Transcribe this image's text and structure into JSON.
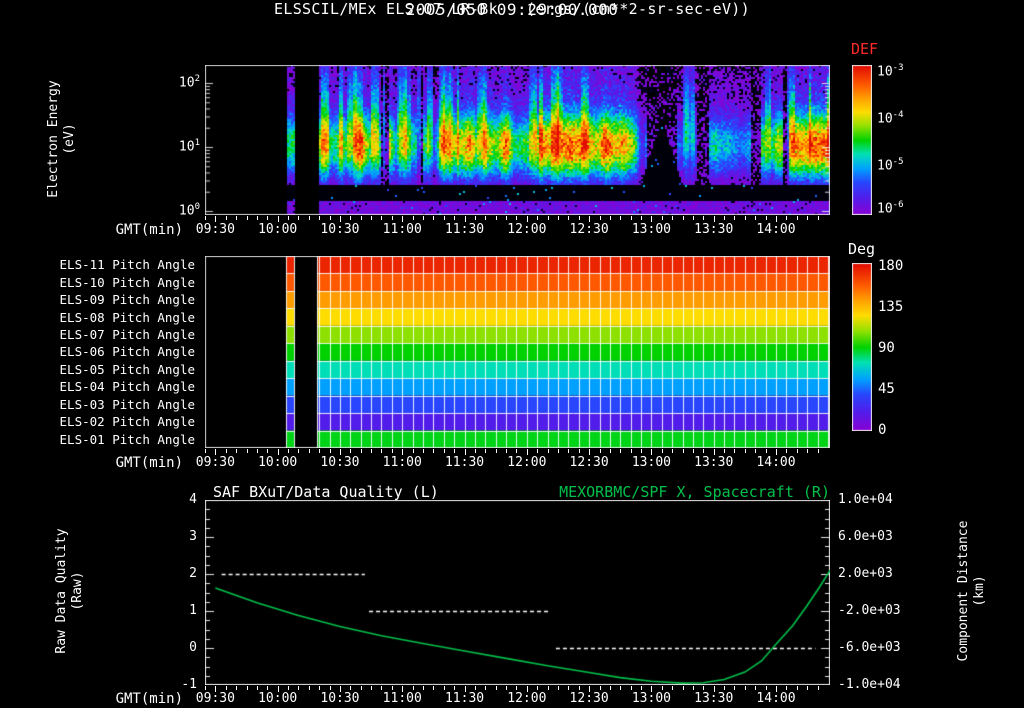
{
  "header": {
    "timestamp": "2005/050 09:29:00.000",
    "instrument_title": "ELSSCIL/MEx ELS-07 LR-Bk",
    "units_title": "(ergs/(cm**2-sr-sec-eV))"
  },
  "time_axis": {
    "label": "GMT(min)",
    "start_min": 565,
    "end_min": 866,
    "major_tick_minutes": [
      570,
      600,
      630,
      660,
      690,
      720,
      750,
      780,
      810,
      840
    ],
    "major_tick_labels": [
      "09:30",
      "10:00",
      "10:30",
      "11:00",
      "11:30",
      "12:00",
      "12:30",
      "13:00",
      "13:30",
      "14:00"
    ],
    "minor_step_min": 5
  },
  "spectrogram_panel": {
    "ylabel": "Electron Energy",
    "ylabel_units": "(eV)",
    "ytick_base": "10",
    "ytick_exponents": [
      "2",
      "1",
      "0"
    ],
    "colorbar_title": "DEF",
    "colorbar_title_color": "#ff2a2a",
    "colorbar_tick_base": "10",
    "colorbar_tick_exponents": [
      "-3",
      "-4",
      "-5",
      "-6"
    ]
  },
  "pitch_colorbar": {
    "title": "Deg",
    "ticks": [
      "180",
      "135",
      "90",
      "45",
      "0"
    ]
  },
  "line_panel": {
    "left_title": "SAF_BXuT/Data Quality (L)",
    "right_title": "MEXORBMC/SPF X, Spacecraft (R)",
    "right_title_color": "#00c04b",
    "left_ylabel": "Raw Data Quality",
    "left_ylabel_units": "(Raw)",
    "right_ylabel": "Component Distance",
    "right_ylabel_units": "(km)",
    "left_ticks": [
      "4",
      "3",
      "2",
      "1",
      "0",
      "-1"
    ],
    "right_ticks": [
      "1.0e+04",
      "6.0e+03",
      "2.0e+03",
      "-2.0e+03",
      "-6.0e+03",
      "-1.0e+04"
    ]
  },
  "chart_data": [
    {
      "type": "heatmap",
      "name": "electron-energy-spectrogram",
      "title": "ELSSCIL/MEx ELS-07 LR-Bk",
      "units": "ergs/(cm**2-sr-sec-eV)",
      "x_range_gmt": [
        "09:25",
        "14:26"
      ],
      "y_axis": {
        "label": "Electron Energy (eV)",
        "scale": "log",
        "range": [
          1,
          200
        ]
      },
      "color_axis": {
        "label": "DEF",
        "scale": "log",
        "range": [
          1e-06,
          0.001
        ]
      },
      "coverage": {
        "first_data_start": "10:04",
        "first_data_end": "10:08",
        "second_data_start": "10:19",
        "data_end": "14:26"
      },
      "features": {
        "main_flux_band_ev": [
          4,
          40
        ],
        "typical_flux": 0.0001,
        "bright_intervals": [
          [
            "10:33",
            "10:41"
          ],
          [
            "10:57",
            "11:04"
          ],
          [
            "11:18",
            "11:24"
          ],
          [
            "11:36",
            "11:41"
          ],
          [
            "12:01",
            "12:05"
          ],
          [
            "12:13",
            "12:17"
          ],
          [
            "12:26",
            "12:30"
          ],
          [
            "13:15",
            "13:19"
          ],
          [
            "13:55",
            "13:58"
          ]
        ],
        "dropout_intervals": [
          [
            "10:50",
            "10:54"
          ],
          [
            "11:07",
            "11:10"
          ],
          [
            "12:58",
            "13:12"
          ],
          [
            "13:22",
            "13:28"
          ],
          [
            "13:48",
            "13:53"
          ],
          [
            "14:03",
            "14:06"
          ]
        ]
      },
      "description": "Broadband electron flux 3-200 eV; strongest between 5 and 40 eV near 1e-4, intermittent bright bursts toward 1e-3 and dark dropouts, large dropout wedge near 13:00."
    },
    {
      "type": "heatmap",
      "name": "pitch-angle-rows",
      "color_axis": {
        "label": "Deg",
        "range": [
          0,
          180
        ]
      },
      "coverage": {
        "first_data_start": "10:04",
        "first_data_end": "10:08",
        "second_data_start": "10:19",
        "data_end": "14:26"
      },
      "rows": [
        {
          "label": "ELS-11 Pitch Angle",
          "angle_deg": 172
        },
        {
          "label": "ELS-10 Pitch Angle",
          "angle_deg": 157
        },
        {
          "label": "ELS-09 Pitch Angle",
          "angle_deg": 141
        },
        {
          "label": "ELS-08 Pitch Angle",
          "angle_deg": 124
        },
        {
          "label": "ELS-07 Pitch Angle",
          "angle_deg": 107
        },
        {
          "label": "ELS-06 Pitch Angle",
          "angle_deg": 90
        },
        {
          "label": "ELS-05 Pitch Angle",
          "angle_deg": 73
        },
        {
          "label": "ELS-04 Pitch Angle",
          "angle_deg": 56
        },
        {
          "label": "ELS-03 Pitch Angle",
          "angle_deg": 39
        },
        {
          "label": "ELS-02 Pitch Angle",
          "angle_deg": 21
        },
        {
          "label": "ELS-01 Pitch Angle",
          "angle_deg": 88
        }
      ],
      "grid_minutes": 5
    },
    {
      "type": "line",
      "name": "quality-and-distance",
      "left_axis": {
        "label": "Raw Data Quality (Raw)",
        "range": [
          -1,
          4
        ]
      },
      "right_axis": {
        "label": "Component Distance (km)",
        "range": [
          -10000,
          10000
        ]
      },
      "series": [
        {
          "name": "SAF_BXuT/Data Quality (L)",
          "axis": "left",
          "color": "#ffffff",
          "style": "dashed",
          "segments": [
            {
              "value": 2,
              "from_min": 573,
              "to_min": 642
            },
            {
              "value": 1,
              "from_min": 644,
              "to_min": 731
            },
            {
              "value": 0,
              "from_min": 734,
              "to_min": 859
            }
          ]
        },
        {
          "name": "MEXORBMC/SPF X, Spacecraft (R)",
          "axis": "left-equivalent",
          "color": "#00c04b",
          "style": "solid",
          "points": [
            [
              570,
              1.62
            ],
            [
              590,
              1.22
            ],
            [
              610,
              0.88
            ],
            [
              630,
              0.58
            ],
            [
              650,
              0.33
            ],
            [
              670,
              0.12
            ],
            [
              690,
              -0.08
            ],
            [
              710,
              -0.28
            ],
            [
              730,
              -0.48
            ],
            [
              750,
              -0.66
            ],
            [
              765,
              -0.8
            ],
            [
              780,
              -0.9
            ],
            [
              795,
              -0.95
            ],
            [
              805,
              -0.94
            ],
            [
              815,
              -0.85
            ],
            [
              825,
              -0.65
            ],
            [
              833,
              -0.35
            ],
            [
              840,
              0.1
            ],
            [
              848,
              0.6
            ],
            [
              855,
              1.15
            ],
            [
              861,
              1.65
            ],
            [
              866,
              2.1
            ]
          ]
        }
      ]
    }
  ]
}
